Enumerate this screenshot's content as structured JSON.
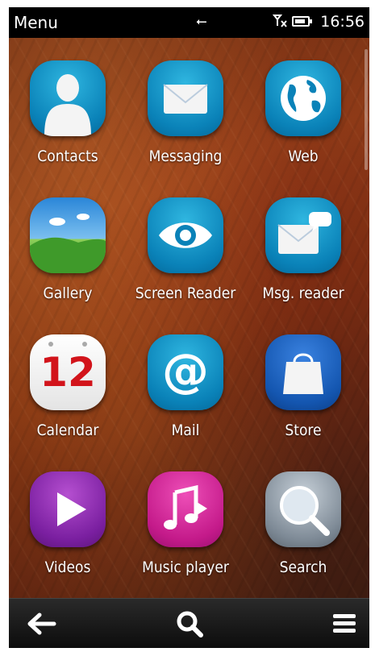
{
  "status_bar": {
    "title": "Menu",
    "time": "16:56",
    "usb_icon": "usb-icon",
    "signal_icon": "no-signal-icon",
    "battery_icon": "battery-icon"
  },
  "apps": [
    {
      "label": "Contacts",
      "icon": "contacts-icon"
    },
    {
      "label": "Messaging",
      "icon": "messaging-icon"
    },
    {
      "label": "Web",
      "icon": "web-globe-icon"
    },
    {
      "label": "Gallery",
      "icon": "gallery-icon"
    },
    {
      "label": "Screen Reader",
      "icon": "screen-reader-eye-icon"
    },
    {
      "label": "Msg. reader",
      "icon": "msg-reader-icon"
    },
    {
      "label": "Calendar",
      "icon": "calendar-icon",
      "badge": "12"
    },
    {
      "label": "Mail",
      "icon": "mail-at-icon"
    },
    {
      "label": "Store",
      "icon": "store-bag-icon"
    },
    {
      "label": "Videos",
      "icon": "videos-play-icon"
    },
    {
      "label": "Music player",
      "icon": "music-player-icon"
    },
    {
      "label": "Search",
      "icon": "search-magnifier-icon"
    }
  ],
  "toolbar": {
    "back_icon": "back-arrow-icon",
    "search_icon": "search-icon",
    "options_icon": "menu-icon"
  },
  "colors": {
    "teal_icon": "#0a82b8",
    "status_bar_bg": "#000000",
    "toolbar_bg": "#151515",
    "label_text": "#ffffff"
  }
}
